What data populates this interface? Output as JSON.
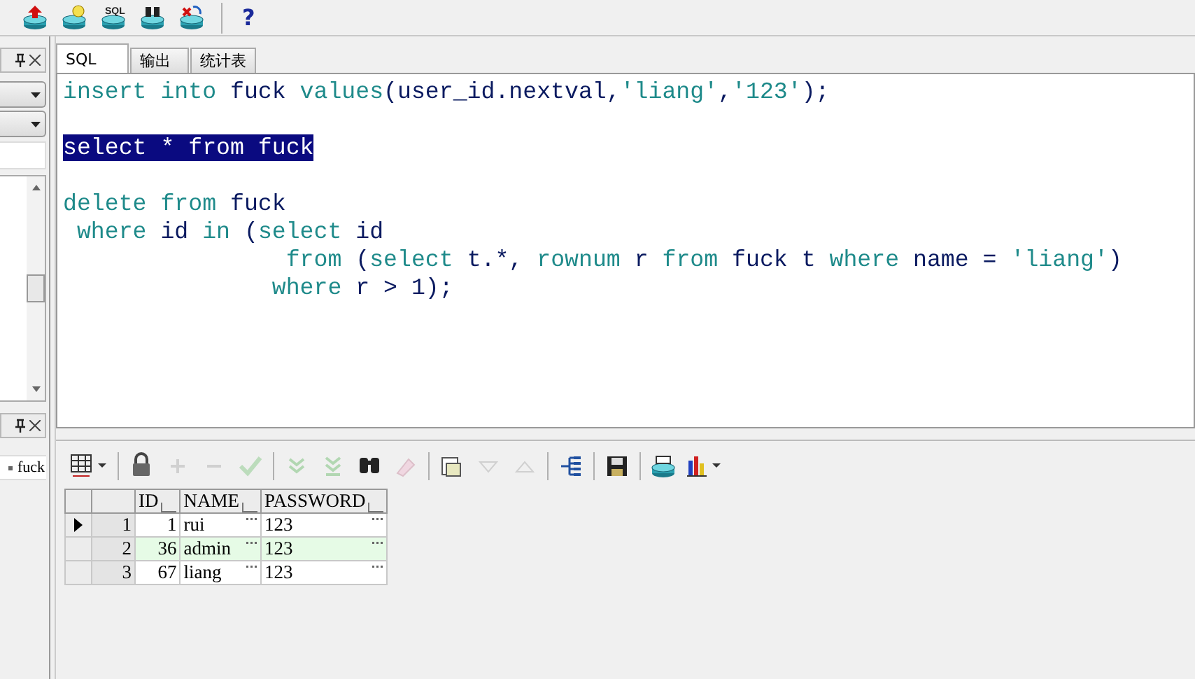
{
  "toolbar": [
    {
      "kind": "db-arrow"
    },
    {
      "kind": "db-bulb"
    },
    {
      "kind": "db-label",
      "label": "SQL"
    },
    {
      "kind": "db-binoculars"
    },
    {
      "kind": "db-cross"
    },
    {
      "kind": "sep"
    },
    {
      "kind": "help",
      "label": "?"
    }
  ],
  "left_panel": {
    "list_item": "fuck"
  },
  "tabs": [
    {
      "label": "SQL",
      "selected": true
    },
    {
      "label": "输出",
      "selected": false
    },
    {
      "label": "统计表",
      "selected": false
    }
  ],
  "editor": {
    "lines": [
      {
        "kind": "code",
        "tokens": [
          {
            "kind": "keyword",
            "text": "insert into"
          },
          {
            "kind": "plain",
            "text": " fuck "
          },
          {
            "kind": "keyword",
            "text": "values"
          },
          {
            "kind": "plain",
            "text": "(user_id.nextval,"
          },
          {
            "kind": "keyword",
            "text": "'liang'"
          },
          {
            "kind": "plain",
            "text": ","
          },
          {
            "kind": "keyword",
            "text": "'123'"
          },
          {
            "kind": "plain",
            "text": ");"
          }
        ]
      },
      {
        "kind": "blank"
      },
      {
        "kind": "code",
        "tokens": [
          {
            "kind": "selected",
            "text": "select * from fuck"
          }
        ]
      },
      {
        "kind": "blank"
      },
      {
        "kind": "code",
        "tokens": [
          {
            "kind": "keyword",
            "text": "delete from"
          },
          {
            "kind": "plain",
            "text": " fuck"
          }
        ]
      },
      {
        "kind": "code",
        "tokens": [
          {
            "kind": "keyword",
            "text": " where "
          },
          {
            "kind": "plain",
            "text": "id "
          },
          {
            "kind": "keyword",
            "text": "in"
          },
          {
            "kind": "plain",
            "text": " ("
          },
          {
            "kind": "keyword",
            "text": "select "
          },
          {
            "kind": "plain",
            "text": "id"
          }
        ]
      },
      {
        "kind": "code",
        "tokens": [
          {
            "kind": "keyword",
            "text": "                from "
          },
          {
            "kind": "plain",
            "text": "("
          },
          {
            "kind": "keyword",
            "text": "select "
          },
          {
            "kind": "plain",
            "text": "t.*, "
          },
          {
            "kind": "keyword",
            "text": "rownum "
          },
          {
            "kind": "plain",
            "text": "r "
          },
          {
            "kind": "keyword",
            "text": "from "
          },
          {
            "kind": "plain",
            "text": "fuck t "
          },
          {
            "kind": "keyword",
            "text": "where "
          },
          {
            "kind": "plain",
            "text": "name = "
          },
          {
            "kind": "keyword",
            "text": "'liang'"
          },
          {
            "kind": "plain",
            "text": ")"
          }
        ]
      },
      {
        "kind": "code",
        "tokens": [
          {
            "kind": "keyword",
            "text": "               where "
          },
          {
            "kind": "plain",
            "text": "r > 1);"
          }
        ]
      }
    ]
  },
  "results_toolbar": [
    {
      "kind": "grid",
      "disabled": false
    },
    {
      "kind": "sep"
    },
    {
      "kind": "lock",
      "disabled": false
    },
    {
      "kind": "plus",
      "disabled": true
    },
    {
      "kind": "minus",
      "disabled": true
    },
    {
      "kind": "check",
      "disabled": true
    },
    {
      "kind": "sep"
    },
    {
      "kind": "chevrons",
      "disabled": true
    },
    {
      "kind": "chevrons-bar",
      "disabled": true
    },
    {
      "kind": "binoculars",
      "disabled": false
    },
    {
      "kind": "eraser",
      "disabled": true
    },
    {
      "kind": "sep"
    },
    {
      "kind": "stack",
      "disabled": false
    },
    {
      "kind": "tri-down",
      "disabled": true
    },
    {
      "kind": "tri-up",
      "disabled": true
    },
    {
      "kind": "sep"
    },
    {
      "kind": "tree",
      "disabled": false
    },
    {
      "kind": "sep"
    },
    {
      "kind": "save",
      "disabled": false
    },
    {
      "kind": "sep"
    },
    {
      "kind": "db",
      "disabled": false
    },
    {
      "kind": "chart",
      "disabled": false
    }
  ],
  "table": {
    "columns": [
      "ID",
      "NAME",
      "PASSWORD"
    ],
    "rows": [
      {
        "number": "1",
        "cells": [
          "1",
          "rui",
          "123"
        ],
        "current": true,
        "highlighted": false
      },
      {
        "number": "2",
        "cells": [
          "36",
          "admin",
          "123"
        ],
        "current": false,
        "highlighted": true
      },
      {
        "number": "3",
        "cells": [
          "67",
          "liang",
          "123"
        ],
        "current": false,
        "highlighted": false
      }
    ]
  }
}
